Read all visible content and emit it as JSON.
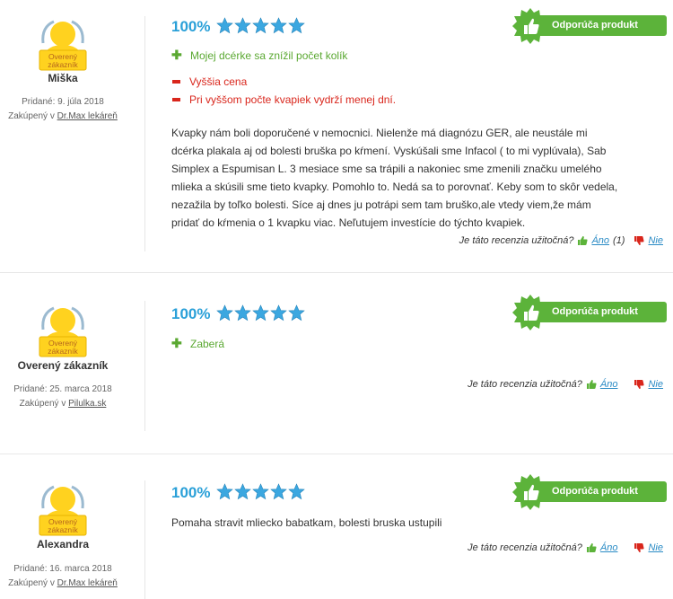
{
  "reviews": [
    {
      "badge_text": [
        "Overený",
        "zákazník"
      ],
      "name": "Miška",
      "added": "Pridané: 9. júla 2018",
      "bought_prefix": "Zakúpený v",
      "bought_store": "Dr.Max lekáreň",
      "percent": "100%",
      "rating_stars": 5,
      "recommend_label": "Odporúča produkt",
      "pros": [
        "Mojej dcérke sa znížil počet kolík"
      ],
      "cons": [
        "Vyššia cena",
        "Pri vyššom počte kvapiek vydrží menej dní."
      ],
      "text_lines": [
        "Kvapky nám boli doporučené v nemocnici. Nielenže má diagnózu GER, ale neustále mi",
        "dcérka plakala aj od bolesti bruška po kŕmení. Vyskúšali sme Infacol ( to mi vyplúvala), Sab",
        "Simplex a Espumisan L. 3 mesiace sme sa trápili a nakoniec sme zmenili značku umelého",
        "mlieka a skúsili sme tieto kvapky. Pomohlo to. Nedá sa to porovnať. Keby som to skôr vedela,",
        "nezažila by toľko bolesti. Síce aj dnes ju potrápi sem tam bruško,ale vtedy viem,že mám",
        "pridať do kŕmenia o 1 kvapku viac. Neľutujem investície do týchto kvapiek."
      ],
      "helpful_question": "Je táto recenzia užitočná?",
      "yes_label": "Áno",
      "yes_count": "(1)",
      "no_label": "Nie"
    },
    {
      "badge_text": [
        "Overený",
        "zákazník"
      ],
      "name": "Overený zákazník",
      "added": "Pridané: 25. marca 2018",
      "bought_prefix": "Zakúpený v",
      "bought_store": "Pilulka.sk",
      "percent": "100%",
      "rating_stars": 5,
      "recommend_label": "Odporúča produkt",
      "pros": [
        "Zaberá"
      ],
      "helpful_question": "Je táto recenzia užitočná?",
      "yes_label": "Áno",
      "no_label": "Nie"
    },
    {
      "badge_text": [
        "Overený",
        "zákazník"
      ],
      "name": "Alexandra",
      "added": "Pridané: 16. marca 2018",
      "bought_prefix": "Zakúpený v",
      "bought_store": "Dr.Max lekáreň",
      "percent": "100%",
      "rating_stars": 5,
      "recommend_label": "Odporúča produkt",
      "text_lines": [
        "Pomaha stravit mliecko babatkam, bolesti bruska ustupili"
      ],
      "helpful_question": "Je táto recenzia užitočná?",
      "yes_label": "Áno",
      "no_label": "Nie"
    }
  ],
  "colors": {
    "accent_blue": "#2aa0d8",
    "recommend_green": "#5cb33a",
    "pro_green": "#5aa831",
    "con_red": "#d9261c",
    "star_fill": "#3ba7e0"
  }
}
